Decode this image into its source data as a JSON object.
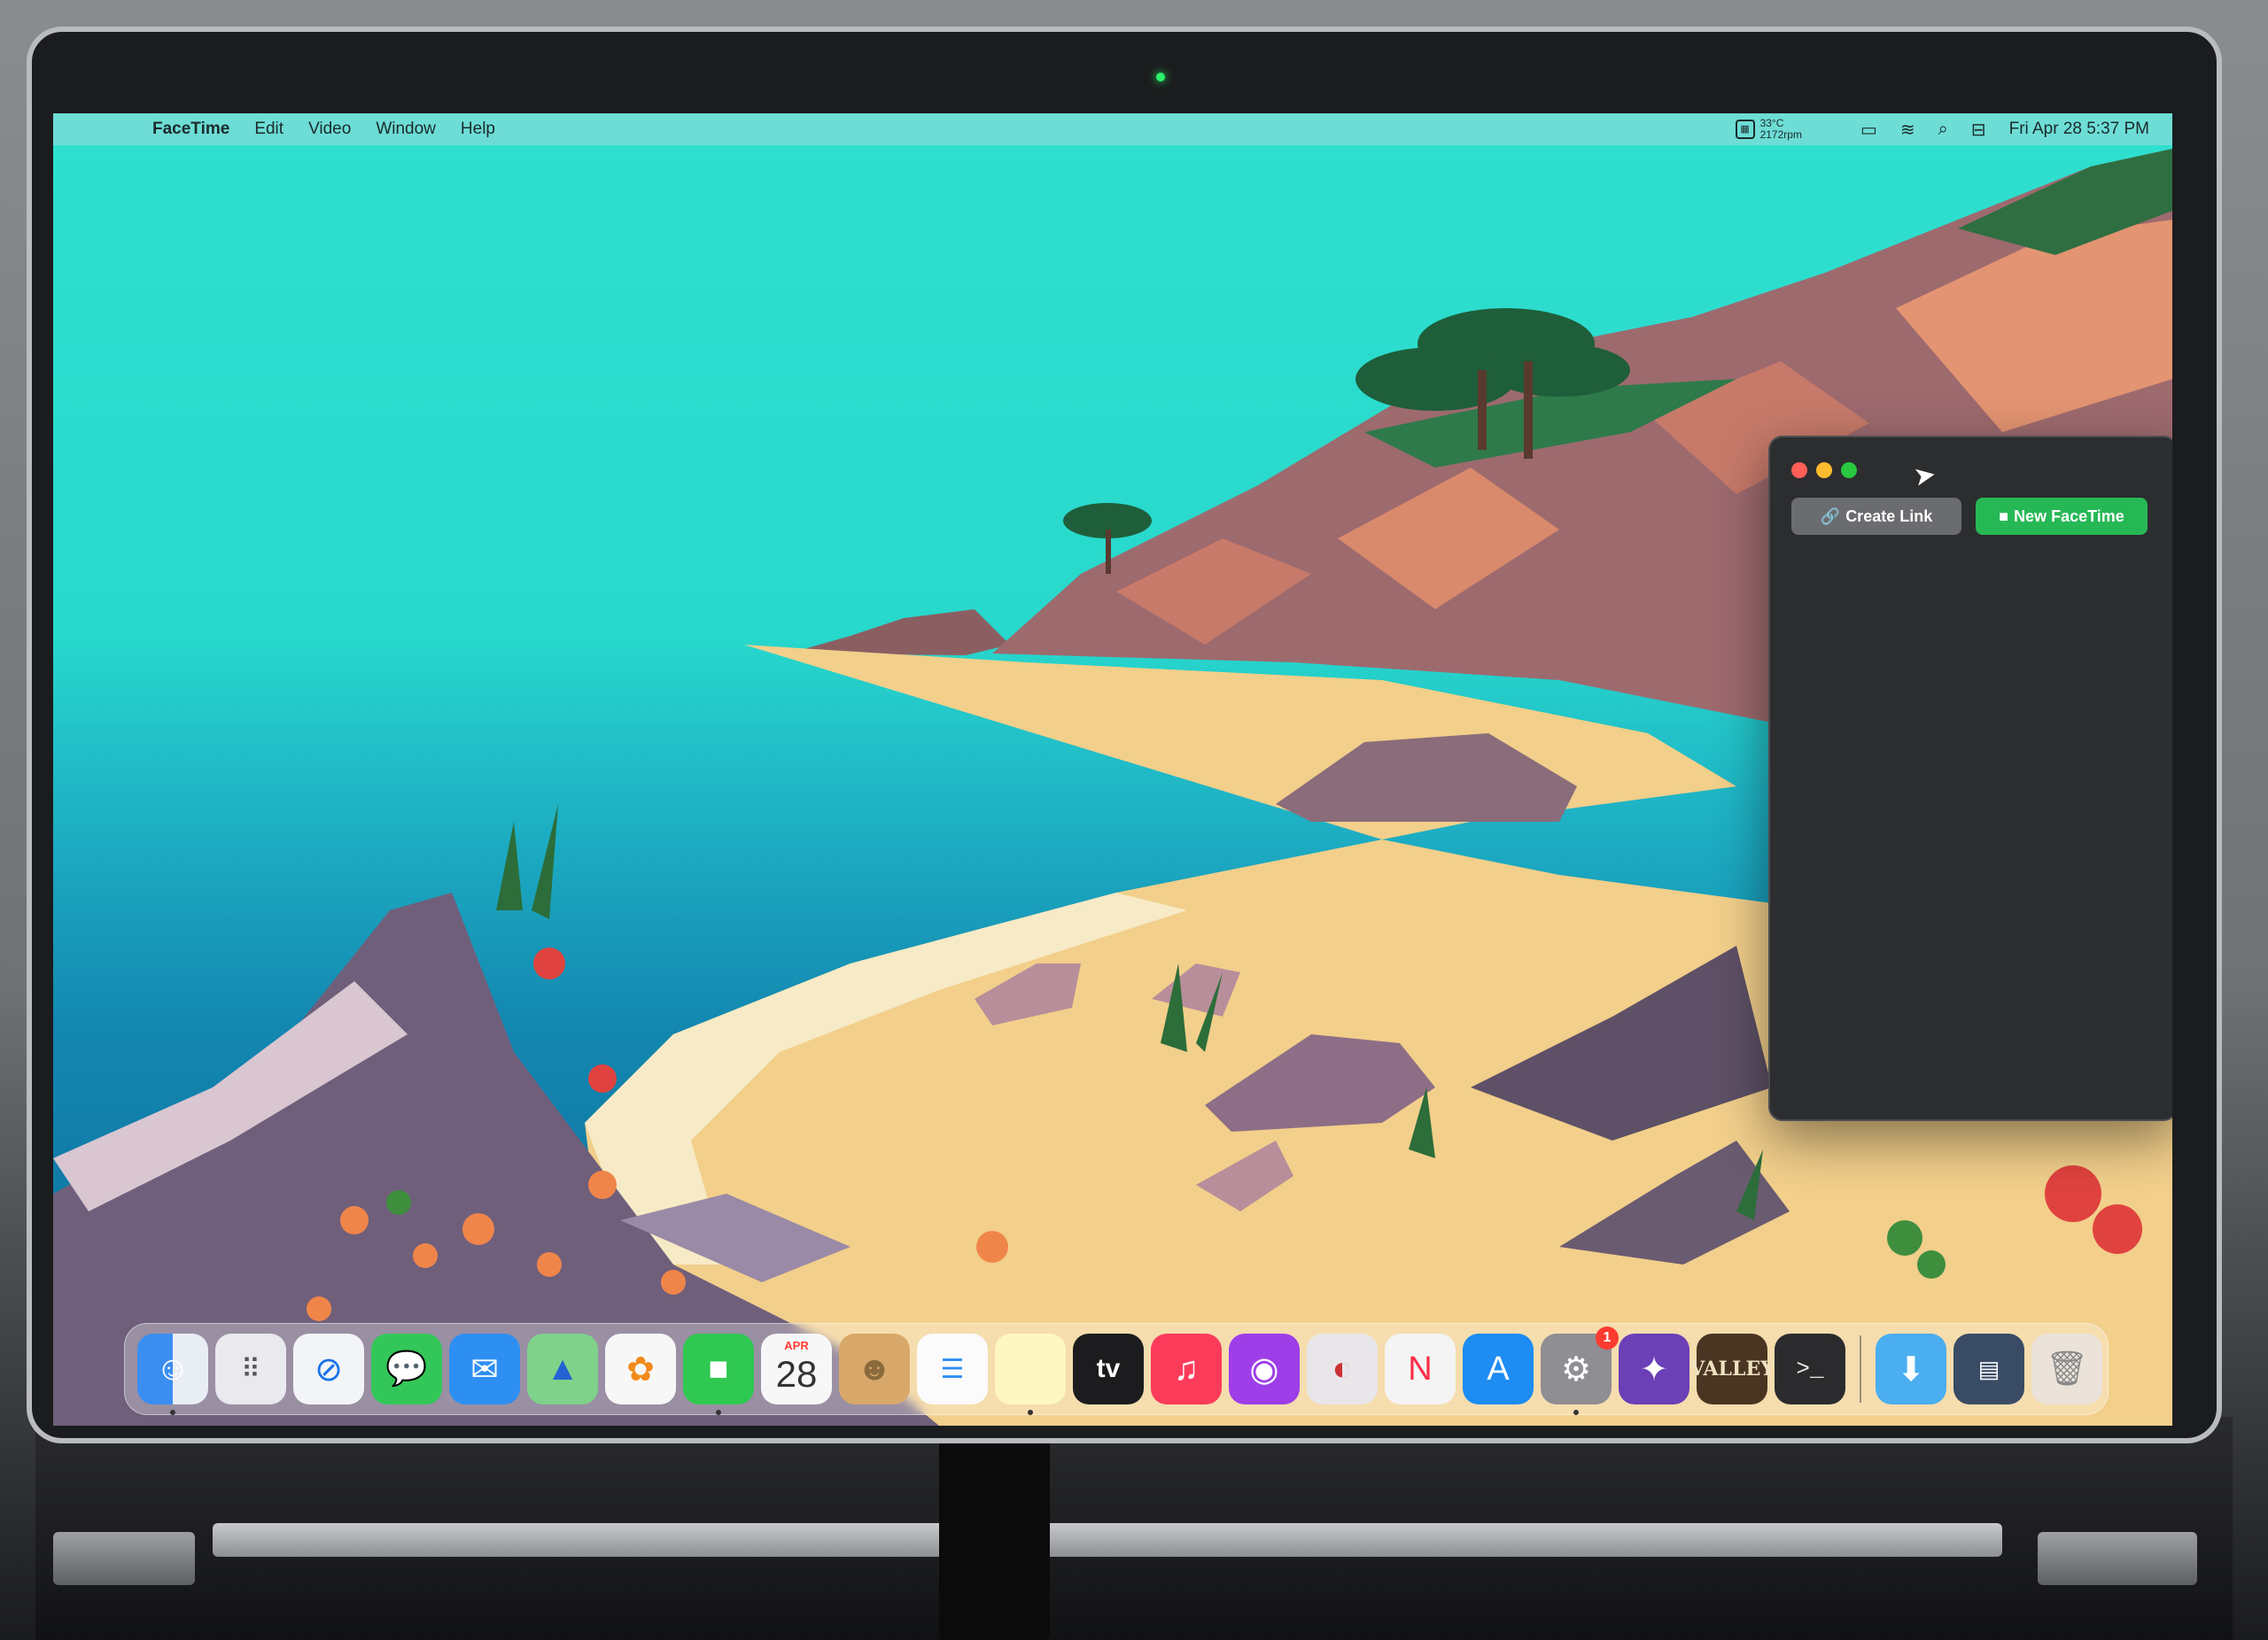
{
  "menubar": {
    "apple_icon": "apple-icon",
    "app_name": "FaceTime",
    "menus": [
      "Edit",
      "Video",
      "Window",
      "Help"
    ],
    "temperature": "33°C",
    "fan_speed": "2172rpm",
    "datetime": "Fri Apr 28  5:37 PM"
  },
  "facetime_window": {
    "create_link_label": "Create Link",
    "new_facetime_label": "New FaceTime"
  },
  "dock": {
    "calendar_month": "APR",
    "calendar_day": "28",
    "appletv_label": "tv",
    "settings_badge": "1",
    "game_label": "VALLEY",
    "items": [
      "Finder",
      "Launchpad",
      "Safari",
      "Messages",
      "Mail",
      "Maps",
      "Photos",
      "FaceTime",
      "Calendar",
      "Contacts",
      "Reminders",
      "Notes",
      "TV",
      "Music",
      "Podcasts",
      "Lost Valley / App",
      "News",
      "App Store",
      "System Settings",
      "Instruments",
      "Valley",
      "Terminal",
      "Downloads",
      "Screenshot",
      "Trash"
    ]
  },
  "colors": {
    "accent_green": "#27b856",
    "window_bg": "#2c2d2f",
    "sky": "#2fe0cf"
  }
}
